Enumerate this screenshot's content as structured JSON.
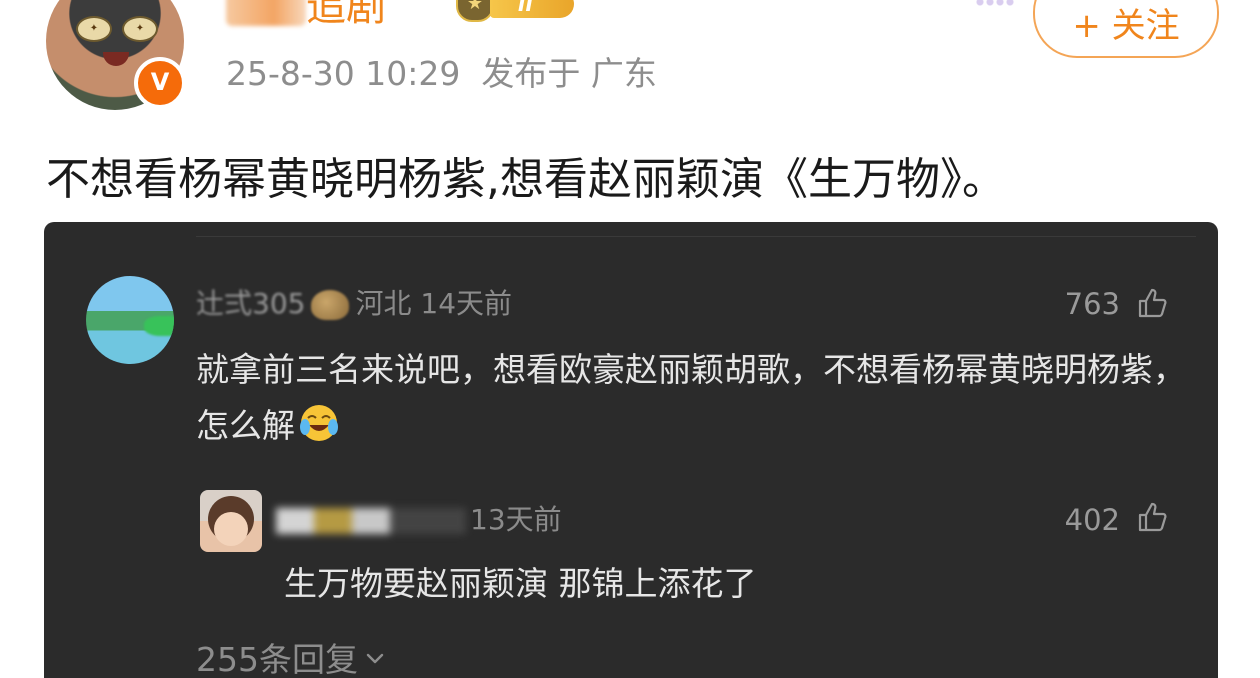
{
  "post": {
    "author_name_visible": "追剧",
    "level_label": "II",
    "verified_mark": "V",
    "timestamp": "25-8-30 10:29",
    "location": "发布于 广东",
    "follow_label": "+ 关注",
    "text": "不想看杨幂黄晓明杨紫,想看赵丽颖演《生万物》。"
  },
  "comment": {
    "user": "辻弍305",
    "location": "河北",
    "time": "14天前",
    "likes": "763",
    "text": "就拿前三名来说吧，想看欧豪赵丽颖胡歌，不想看杨幂黄晓明杨紫，怎么解",
    "emoji": "laughing-crying-emoji"
  },
  "reply": {
    "meta": "13天前",
    "likes": "402",
    "text": "生万物要赵丽颖演 那锦上添花了"
  },
  "reply_count_label": "255条回复",
  "colors": {
    "accent": "#f0851c",
    "card_bg": "#2b2b2b",
    "muted": "#8d8d8d"
  }
}
